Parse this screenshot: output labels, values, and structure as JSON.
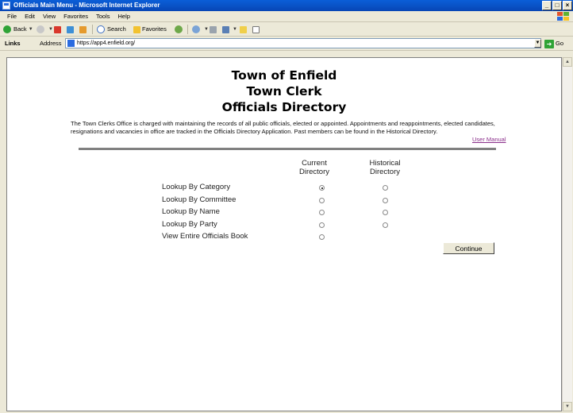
{
  "window": {
    "title": "Officials Main Menu - Microsoft Internet Explorer",
    "buttons": [
      "_",
      "□",
      "×"
    ]
  },
  "menu": [
    "File",
    "Edit",
    "View",
    "Favorites",
    "Tools",
    "Help"
  ],
  "toolbar": {
    "back_label": "Back",
    "search_label": "Search",
    "favorites_label": "Favorites"
  },
  "address_bar": {
    "links_label": "Links",
    "address_label": "Address",
    "url": "https://app4.enfield.org/",
    "go_label": "Go"
  },
  "page": {
    "heading_line1": "Town of Enfield",
    "heading_line2": "Town Clerk",
    "heading_line3": "Officials Directory",
    "intro": "The Town Clerks Office is charged with maintaining the records of all public officials, elected or appointed. Appointments and reappointments, elected candidates, resignations and vacancies in office are tracked in the Officials Directory Application. Past members can be found in the Historical Directory.",
    "user_manual_link": "User Manual",
    "col_current": "Current Directory",
    "col_historical": "Historical Directory",
    "options": [
      {
        "label": "Lookup By Category",
        "current_selected": true,
        "historical_available": true
      },
      {
        "label": "Lookup By Committee",
        "current_selected": false,
        "historical_available": true
      },
      {
        "label": "Lookup By Name",
        "current_selected": false,
        "historical_available": true
      },
      {
        "label": "Lookup By Party",
        "current_selected": false,
        "historical_available": true
      },
      {
        "label": "View Entire Officials Book",
        "current_selected": false,
        "historical_available": false
      }
    ],
    "continue_label": "Continue"
  },
  "colors": {
    "titlebar": "#0a5fd8",
    "link_visited": "#8b2f8b",
    "divider": "#808080"
  }
}
